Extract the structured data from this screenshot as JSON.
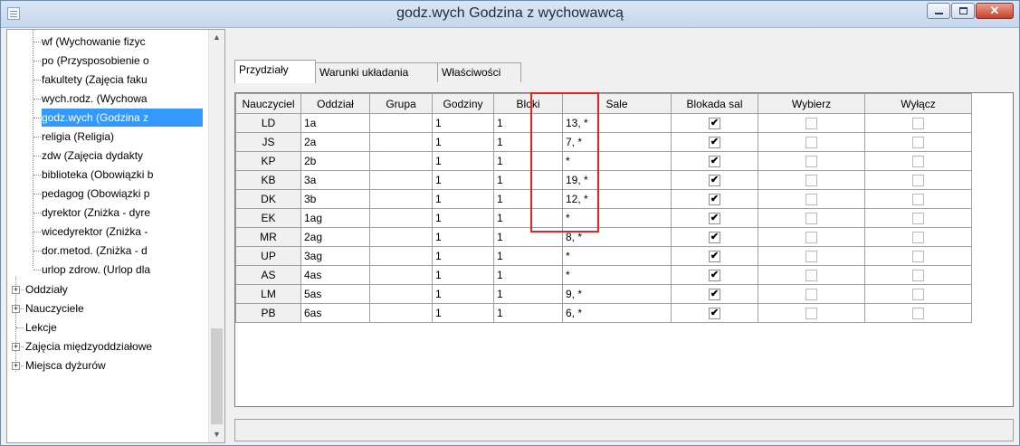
{
  "window": {
    "title": "godz.wych Godzina z wychowawcą",
    "close_glyph": "✕"
  },
  "tree": {
    "children": [
      {
        "label": "wf (Wychowanie fizyc"
      },
      {
        "label": "po (Przysposobienie o"
      },
      {
        "label": "fakultety (Zajęcia faku"
      },
      {
        "label": "wych.rodz. (Wychowa"
      },
      {
        "label": "godz.wych (Godzina z",
        "selected": true
      },
      {
        "label": "religia (Religia)"
      },
      {
        "label": "zdw (Zajęcia dydakty"
      },
      {
        "label": "biblioteka (Obowiązki b"
      },
      {
        "label": "pedagog (Obowiązki p"
      },
      {
        "label": "dyrektor (Zniżka - dyre"
      },
      {
        "label": "wicedyrektor (Zniżka -"
      },
      {
        "label": "dor.metod. (Zniżka - d"
      },
      {
        "label": "urlop zdrow. (Urlop dla"
      }
    ],
    "roots": [
      {
        "label": "Oddziały",
        "expander": "+"
      },
      {
        "label": "Nauczyciele",
        "expander": "+"
      },
      {
        "label": "Lekcje",
        "expander": ""
      },
      {
        "label": "Zajęcia międzyoddziałowe",
        "expander": "+"
      },
      {
        "label": "Miejsca dyżurów",
        "expander": "+"
      }
    ],
    "scroll_up": "▲",
    "scroll_down": "▼"
  },
  "tabs": [
    {
      "label": "Przydziały",
      "active": true
    },
    {
      "label": "Warunki układania"
    },
    {
      "label": "Właściwości"
    }
  ],
  "table": {
    "headers": [
      "Nauczyciel",
      "Oddział",
      "Grupa",
      "Godziny",
      "Bloki",
      "Sale",
      "Blokada sal",
      "Wybierz",
      "Wyłącz"
    ],
    "rows": [
      {
        "teacher": "LD",
        "class": "1a",
        "group": "",
        "hours": "1",
        "blocks": "1",
        "rooms": "13, *",
        "lock": true,
        "select": false,
        "exclude": false
      },
      {
        "teacher": "JS",
        "class": "2a",
        "group": "",
        "hours": "1",
        "blocks": "1",
        "rooms": "7, *",
        "lock": true,
        "select": false,
        "exclude": false
      },
      {
        "teacher": "KP",
        "class": "2b",
        "group": "",
        "hours": "1",
        "blocks": "1",
        "rooms": "*",
        "lock": true,
        "select": false,
        "exclude": false
      },
      {
        "teacher": "KB",
        "class": "3a",
        "group": "",
        "hours": "1",
        "blocks": "1",
        "rooms": "19, *",
        "lock": true,
        "select": false,
        "exclude": false
      },
      {
        "teacher": "DK",
        "class": "3b",
        "group": "",
        "hours": "1",
        "blocks": "1",
        "rooms": "12, *",
        "lock": true,
        "select": false,
        "exclude": false
      },
      {
        "teacher": "EK",
        "class": "1ag",
        "group": "",
        "hours": "1",
        "blocks": "1",
        "rooms": "*",
        "lock": true,
        "select": false,
        "exclude": false
      },
      {
        "teacher": "MR",
        "class": "2ag",
        "group": "",
        "hours": "1",
        "blocks": "1",
        "rooms": "8, *",
        "lock": true,
        "select": false,
        "exclude": false
      },
      {
        "teacher": "UP",
        "class": "3ag",
        "group": "",
        "hours": "1",
        "blocks": "1",
        "rooms": "*",
        "lock": true,
        "select": false,
        "exclude": false
      },
      {
        "teacher": "AS",
        "class": "4as",
        "group": "",
        "hours": "1",
        "blocks": "1",
        "rooms": "*",
        "lock": true,
        "select": false,
        "exclude": false
      },
      {
        "teacher": "LM",
        "class": "5as",
        "group": "",
        "hours": "1",
        "blocks": "1",
        "rooms": "9, *",
        "lock": true,
        "select": false,
        "exclude": false
      },
      {
        "teacher": "PB",
        "class": "6as",
        "group": "",
        "hours": "1",
        "blocks": "1",
        "rooms": "6, *",
        "lock": true,
        "select": false,
        "exclude": false
      }
    ],
    "check_glyph": "✔"
  },
  "colors": {
    "selection": "#3399ff",
    "highlight_border": "#e32323"
  }
}
